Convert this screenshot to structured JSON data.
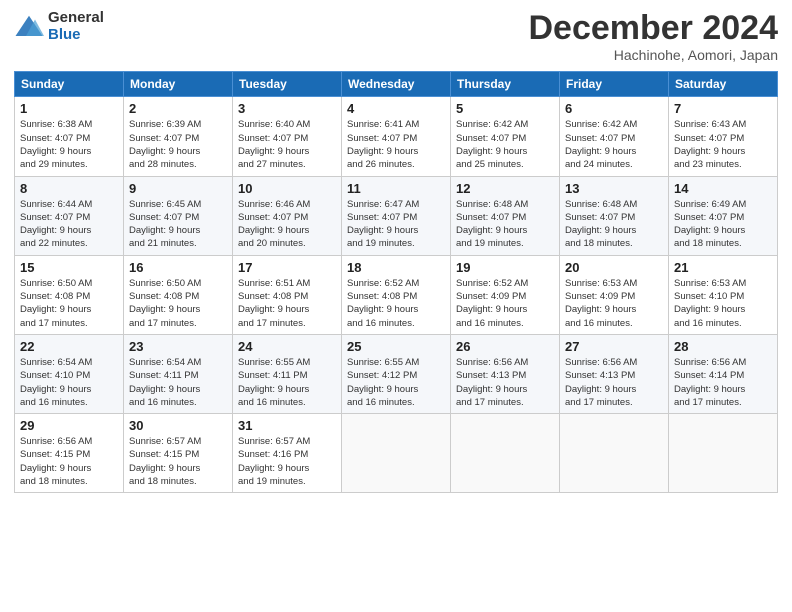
{
  "header": {
    "logo_general": "General",
    "logo_blue": "Blue",
    "title": "December 2024",
    "subtitle": "Hachinohe, Aomori, Japan"
  },
  "days_of_week": [
    "Sunday",
    "Monday",
    "Tuesday",
    "Wednesday",
    "Thursday",
    "Friday",
    "Saturday"
  ],
  "weeks": [
    [
      {
        "day": "1",
        "sunrise": "6:38 AM",
        "sunset": "4:07 PM",
        "daylight": "9 hours and 29 minutes."
      },
      {
        "day": "2",
        "sunrise": "6:39 AM",
        "sunset": "4:07 PM",
        "daylight": "9 hours and 28 minutes."
      },
      {
        "day": "3",
        "sunrise": "6:40 AM",
        "sunset": "4:07 PM",
        "daylight": "9 hours and 27 minutes."
      },
      {
        "day": "4",
        "sunrise": "6:41 AM",
        "sunset": "4:07 PM",
        "daylight": "9 hours and 26 minutes."
      },
      {
        "day": "5",
        "sunrise": "6:42 AM",
        "sunset": "4:07 PM",
        "daylight": "9 hours and 25 minutes."
      },
      {
        "day": "6",
        "sunrise": "6:42 AM",
        "sunset": "4:07 PM",
        "daylight": "9 hours and 24 minutes."
      },
      {
        "day": "7",
        "sunrise": "6:43 AM",
        "sunset": "4:07 PM",
        "daylight": "9 hours and 23 minutes."
      }
    ],
    [
      {
        "day": "8",
        "sunrise": "6:44 AM",
        "sunset": "4:07 PM",
        "daylight": "9 hours and 22 minutes."
      },
      {
        "day": "9",
        "sunrise": "6:45 AM",
        "sunset": "4:07 PM",
        "daylight": "9 hours and 21 minutes."
      },
      {
        "day": "10",
        "sunrise": "6:46 AM",
        "sunset": "4:07 PM",
        "daylight": "9 hours and 20 minutes."
      },
      {
        "day": "11",
        "sunrise": "6:47 AM",
        "sunset": "4:07 PM",
        "daylight": "9 hours and 19 minutes."
      },
      {
        "day": "12",
        "sunrise": "6:48 AM",
        "sunset": "4:07 PM",
        "daylight": "9 hours and 19 minutes."
      },
      {
        "day": "13",
        "sunrise": "6:48 AM",
        "sunset": "4:07 PM",
        "daylight": "9 hours and 18 minutes."
      },
      {
        "day": "14",
        "sunrise": "6:49 AM",
        "sunset": "4:07 PM",
        "daylight": "9 hours and 18 minutes."
      }
    ],
    [
      {
        "day": "15",
        "sunrise": "6:50 AM",
        "sunset": "4:08 PM",
        "daylight": "9 hours and 17 minutes."
      },
      {
        "day": "16",
        "sunrise": "6:50 AM",
        "sunset": "4:08 PM",
        "daylight": "9 hours and 17 minutes."
      },
      {
        "day": "17",
        "sunrise": "6:51 AM",
        "sunset": "4:08 PM",
        "daylight": "9 hours and 17 minutes."
      },
      {
        "day": "18",
        "sunrise": "6:52 AM",
        "sunset": "4:08 PM",
        "daylight": "9 hours and 16 minutes."
      },
      {
        "day": "19",
        "sunrise": "6:52 AM",
        "sunset": "4:09 PM",
        "daylight": "9 hours and 16 minutes."
      },
      {
        "day": "20",
        "sunrise": "6:53 AM",
        "sunset": "4:09 PM",
        "daylight": "9 hours and 16 minutes."
      },
      {
        "day": "21",
        "sunrise": "6:53 AM",
        "sunset": "4:10 PM",
        "daylight": "9 hours and 16 minutes."
      }
    ],
    [
      {
        "day": "22",
        "sunrise": "6:54 AM",
        "sunset": "4:10 PM",
        "daylight": "9 hours and 16 minutes."
      },
      {
        "day": "23",
        "sunrise": "6:54 AM",
        "sunset": "4:11 PM",
        "daylight": "9 hours and 16 minutes."
      },
      {
        "day": "24",
        "sunrise": "6:55 AM",
        "sunset": "4:11 PM",
        "daylight": "9 hours and 16 minutes."
      },
      {
        "day": "25",
        "sunrise": "6:55 AM",
        "sunset": "4:12 PM",
        "daylight": "9 hours and 16 minutes."
      },
      {
        "day": "26",
        "sunrise": "6:56 AM",
        "sunset": "4:13 PM",
        "daylight": "9 hours and 17 minutes."
      },
      {
        "day": "27",
        "sunrise": "6:56 AM",
        "sunset": "4:13 PM",
        "daylight": "9 hours and 17 minutes."
      },
      {
        "day": "28",
        "sunrise": "6:56 AM",
        "sunset": "4:14 PM",
        "daylight": "9 hours and 17 minutes."
      }
    ],
    [
      {
        "day": "29",
        "sunrise": "6:56 AM",
        "sunset": "4:15 PM",
        "daylight": "9 hours and 18 minutes."
      },
      {
        "day": "30",
        "sunrise": "6:57 AM",
        "sunset": "4:15 PM",
        "daylight": "9 hours and 18 minutes."
      },
      {
        "day": "31",
        "sunrise": "6:57 AM",
        "sunset": "4:16 PM",
        "daylight": "9 hours and 19 minutes."
      },
      null,
      null,
      null,
      null
    ]
  ],
  "labels": {
    "sunrise": "Sunrise:",
    "sunset": "Sunset:",
    "daylight": "Daylight:"
  }
}
